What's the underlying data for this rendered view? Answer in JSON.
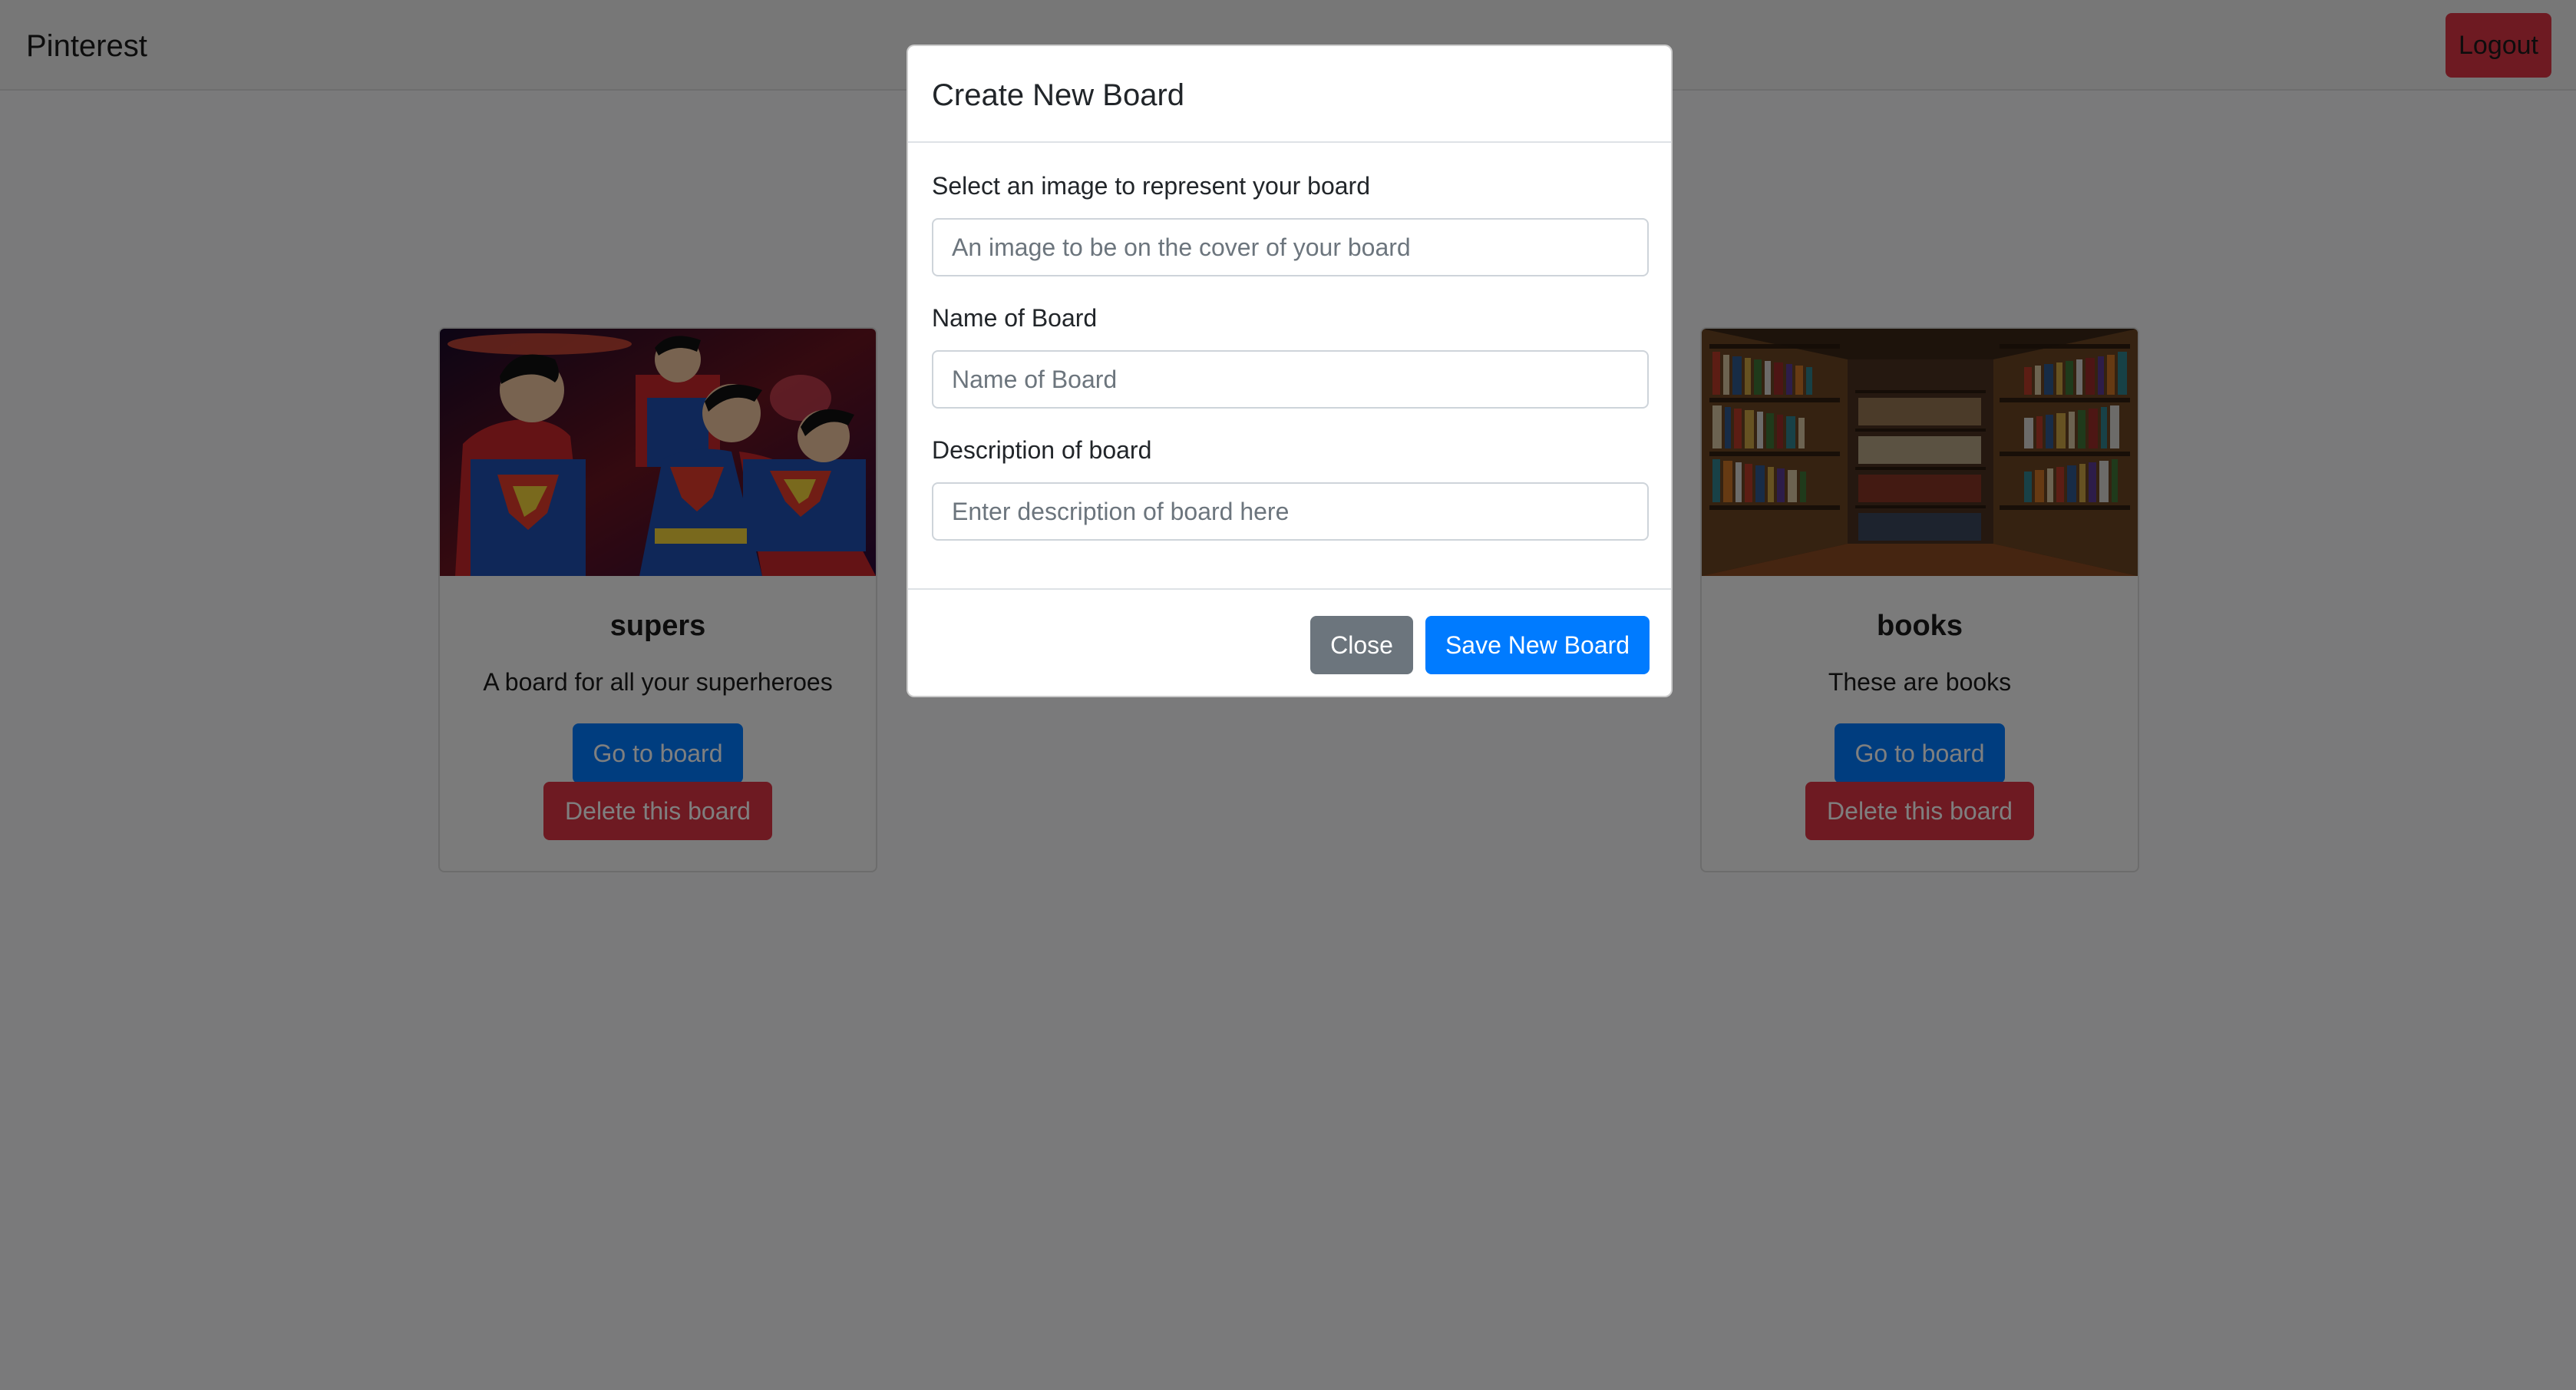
{
  "navbar": {
    "brand": "Pinterest",
    "logout_label": "Logout"
  },
  "boards": [
    {
      "title": "supers",
      "description": "A board for all your superheroes",
      "go_label": "Go to board",
      "delete_label": "Delete this board",
      "image": "superman-heroes-image"
    },
    {
      "title": "books",
      "description": "These are books",
      "go_label": "Go to board",
      "delete_label": "Delete this board",
      "image": "library-bookshelves-image"
    }
  ],
  "modal": {
    "title": "Create New Board",
    "image_label": "Select an image to represent your board",
    "image_placeholder": "An image to be on the cover of your board",
    "name_label": "Name of Board",
    "name_placeholder": "Name of Board",
    "description_label": "Description of board",
    "description_placeholder": "Enter description of board here",
    "close_label": "Close",
    "save_label": "Save New Board"
  },
  "colors": {
    "primary": "#007bff",
    "danger": "#dc3545",
    "secondary": "#6c757d"
  }
}
